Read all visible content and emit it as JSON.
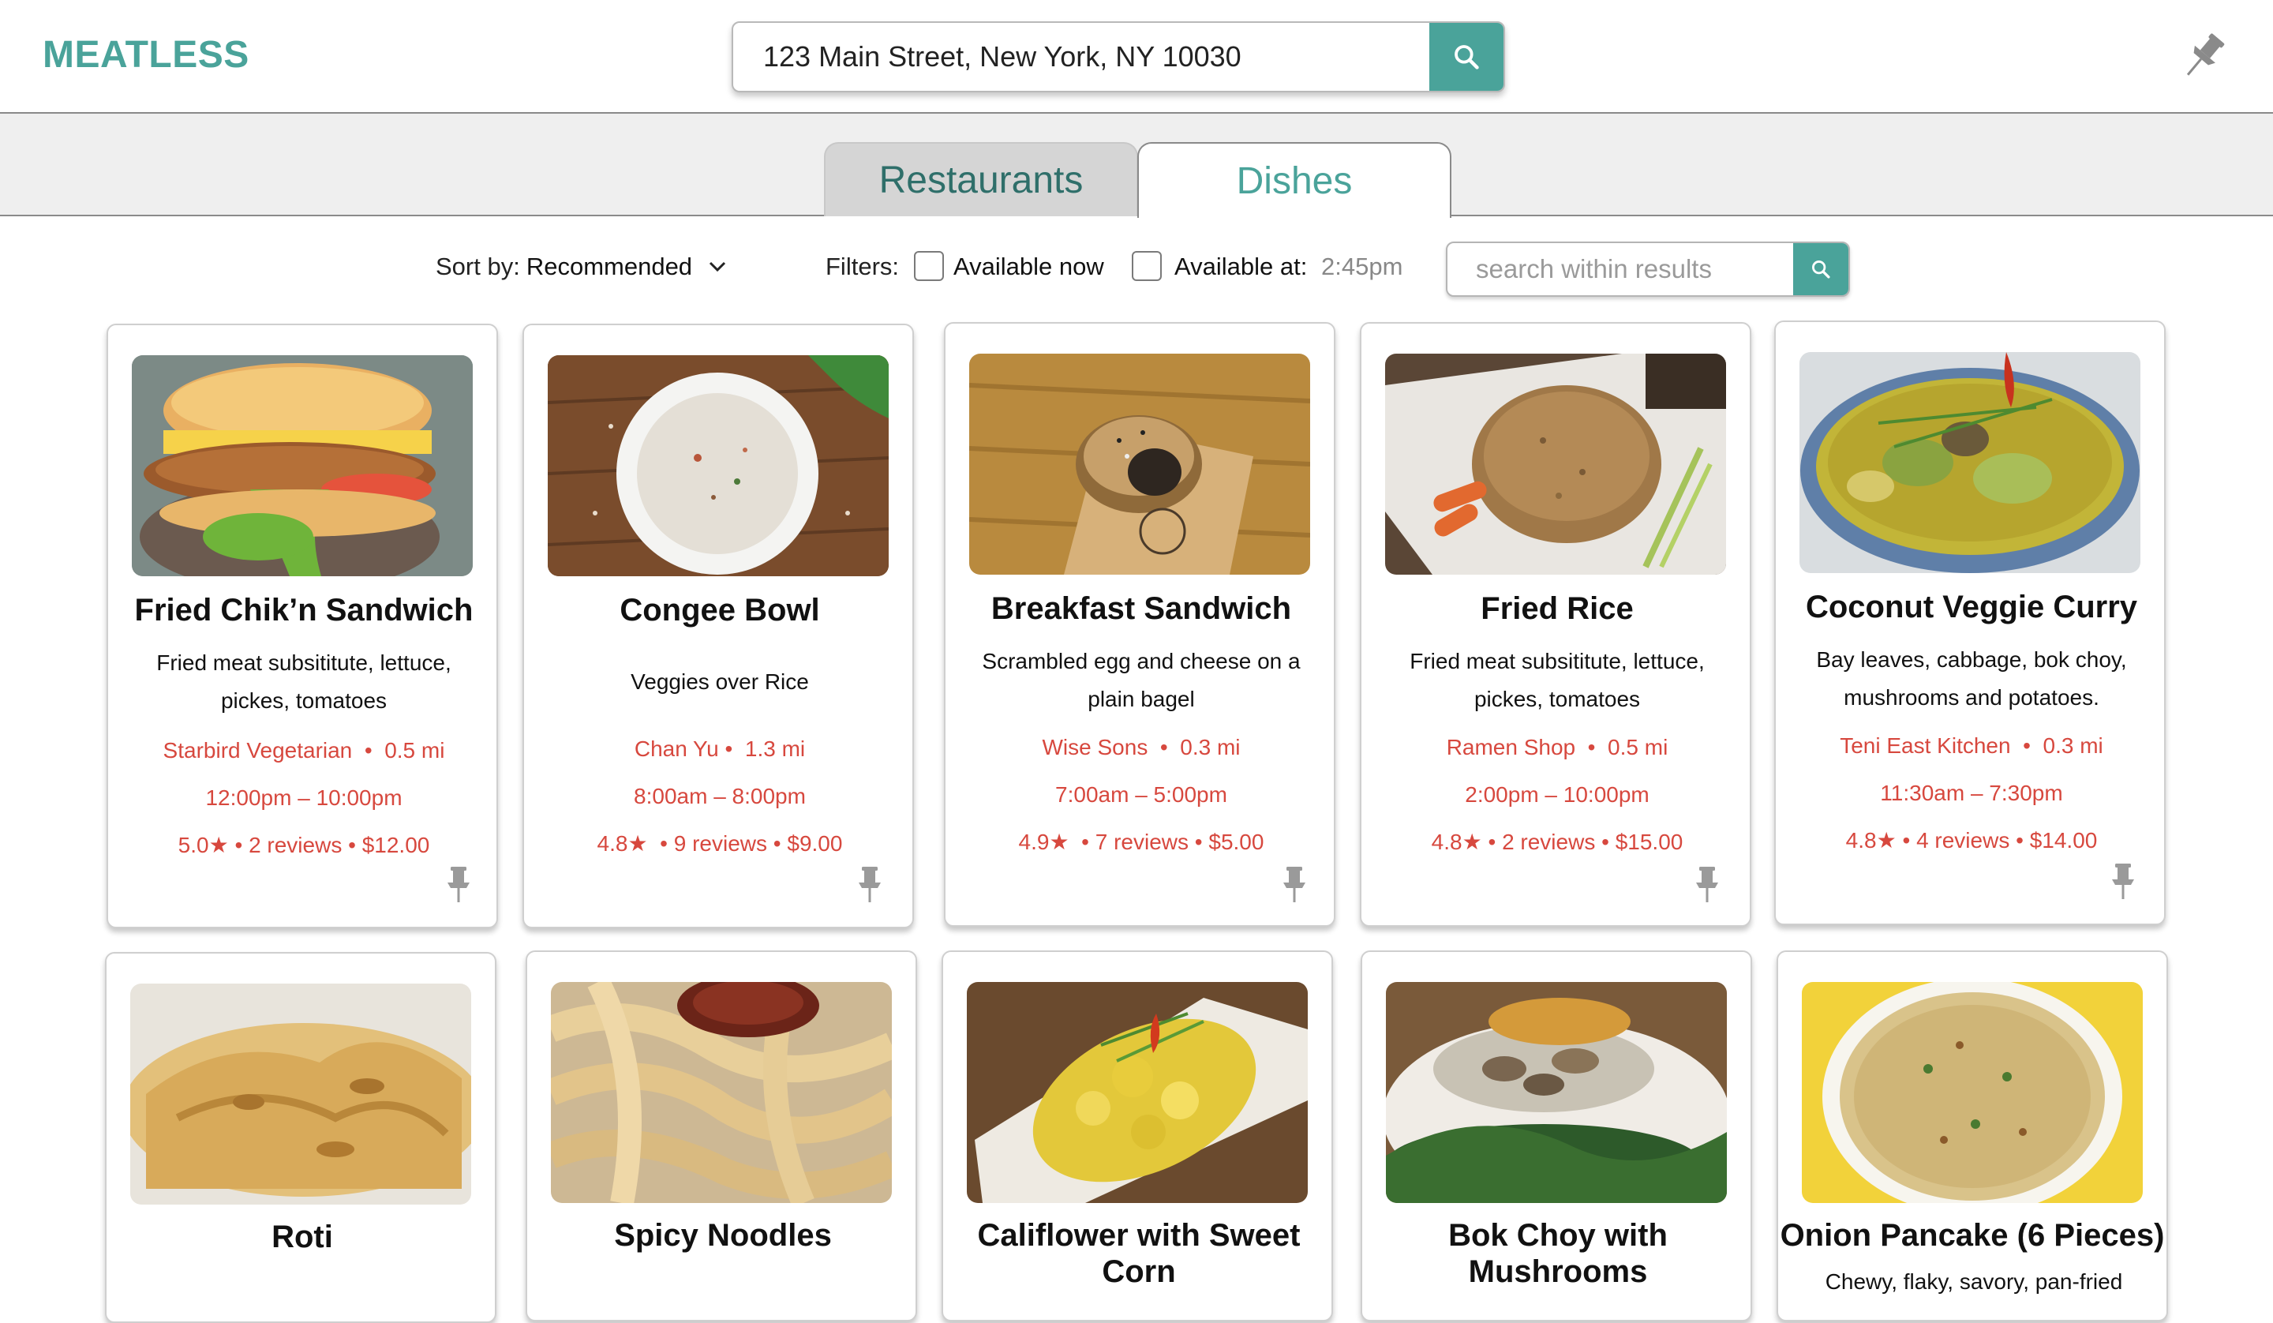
{
  "app": {
    "logo": "MEATLESS"
  },
  "address": {
    "value": "123 Main Street, New York, NY 10030",
    "button_icon": "search-icon"
  },
  "tabs": {
    "restaurants": "Restaurants",
    "dishes": "Dishes",
    "active": "Dishes"
  },
  "controls": {
    "sort_label": "Sort by:",
    "sort_value": "Recommended",
    "filters_label": "Filters:",
    "available_now": "Available now",
    "available_at": "Available at:",
    "available_time": "2:45pm",
    "search_placeholder": "search within results"
  },
  "colors": {
    "accent": "#4aa39a",
    "meta": "#d7483e",
    "tab_inactive": "#d5d5d5"
  },
  "dishes": [
    {
      "title": "Fried Chik’n Sandwich",
      "desc": "Fried meat subsititute, lettuce, pickes, tomatoes",
      "place": "Starbird Vegetarian",
      "distance": "0.5 mi",
      "hours": "12:00pm – 10:00pm",
      "rating": "5.0",
      "reviews": "2 reviews",
      "price": "$12.00"
    },
    {
      "title": "Congee Bowl",
      "desc": "Veggies over Rice",
      "place": "Chan Yu",
      "distance": "1.3 mi",
      "hours": "8:00am – 8:00pm",
      "rating": "4.8",
      "reviews": "9 reviews",
      "price": "$9.00"
    },
    {
      "title": "Breakfast Sandwich",
      "desc": "Scrambled egg and cheese on a plain bagel",
      "place": "Wise Sons",
      "distance": "0.3 mi",
      "hours": "7:00am – 5:00pm",
      "rating": "4.9",
      "reviews": "7 reviews",
      "price": "$5.00"
    },
    {
      "title": "Fried Rice",
      "desc": "Fried meat subsititute, lettuce, pickes, tomatoes",
      "place": "Ramen Shop",
      "distance": "0.5 mi",
      "hours": "2:00pm – 10:00pm",
      "rating": "4.8",
      "reviews": "2 reviews",
      "price": "$15.00"
    },
    {
      "title": "Coconut Veggie Curry",
      "desc": "Bay leaves, cabbage, bok choy, mushrooms and potatoes.",
      "place": "Teni East Kitchen",
      "distance": "0.3 mi",
      "hours": "11:30am – 7:30pm",
      "rating": "4.8",
      "reviews": "4 reviews",
      "price": "$14.00"
    },
    {
      "title": "Roti"
    },
    {
      "title": "Spicy Noodles"
    },
    {
      "title": "Califlower with Sweet Corn"
    },
    {
      "title": "Bok Choy with Mushrooms"
    },
    {
      "title": "Onion Pancake (6 Pieces)",
      "desc": "Chewy, flaky, savory, pan-fried"
    }
  ]
}
